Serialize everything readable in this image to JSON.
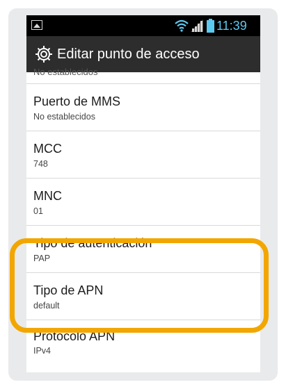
{
  "status_bar": {
    "time": "11:39",
    "icons": [
      "gallery-icon",
      "wifi-icon",
      "signal-icon",
      "battery-icon"
    ],
    "time_color": "#5cc9f0"
  },
  "action_bar": {
    "icon": "gear-icon",
    "title": "Editar punto de acceso"
  },
  "list": {
    "clipped_summary": "No establecidos",
    "items": [
      {
        "title": "Puerto de MMS",
        "summary": "No establecidos"
      },
      {
        "title": "MCC",
        "summary": "748"
      },
      {
        "title": "MNC",
        "summary": "01"
      },
      {
        "title": "Tipo de autenticación",
        "summary": "PAP"
      },
      {
        "title": "Tipo de APN",
        "summary": "default"
      },
      {
        "title": "Protocolo APN",
        "summary": "IPv4"
      }
    ]
  },
  "highlight": {
    "color": "#f2a600",
    "covers_items": [
      "Tipo de autenticación",
      "Tipo de APN"
    ]
  }
}
